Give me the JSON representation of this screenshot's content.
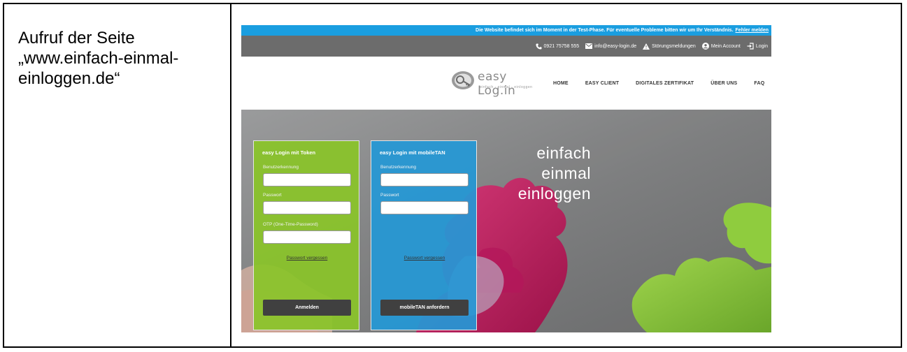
{
  "caption": {
    "line1": "Aufruf der Seite",
    "line2": "„www.einfach-einmal-",
    "line3": "einloggen.de“"
  },
  "site": {
    "notice": {
      "text": "Die Website befindet sich im Moment in der Test-Phase. Für eventuelle Probleme bitten wir um Ihr Verständnis.",
      "link": "Fehler melden"
    },
    "topbar": {
      "phone": "0921 75758 555",
      "email": "info@easy-login.de",
      "status": "Störungsmeldungen",
      "account": "Mein Account",
      "login": "Login"
    },
    "logo": {
      "name": "easy Log.in",
      "tagline": "einfach · einmal · einloggen"
    },
    "nav": [
      "HOME",
      "EASY CLIENT",
      "DIGITALES ZERTIFIKAT",
      "ÜBER UNS",
      "FAQ"
    ],
    "token_panel": {
      "title": "easy Login mit Token",
      "username_label": "Benutzerkennung",
      "password_label": "Passwort",
      "otp_label": "OTP (One-Time-Password)",
      "forgot": "Passwort vergessen",
      "button": "Anmelden"
    },
    "mtan_panel": {
      "title": "easy Login mit mobileTAN",
      "username_label": "Benutzerkennung",
      "password_label": "Passwort",
      "forgot": "Passwort vergessen",
      "button": "mobileTAN anfordern"
    },
    "slogan": [
      "einfach",
      "einmal",
      "einloggen"
    ]
  },
  "colors": {
    "notice_bar": "#1a9ee0",
    "top_bar": "#6c6c6c",
    "token_panel": "#8ac429",
    "mtan_panel": "#2498d6",
    "button": "#404040",
    "puzzle_pink": "#c2185b",
    "puzzle_green": "#86c23a"
  },
  "icons": [
    "phone-icon",
    "mail-icon",
    "warning-icon",
    "account-icon",
    "login-icon",
    "logo-key-icon"
  ]
}
